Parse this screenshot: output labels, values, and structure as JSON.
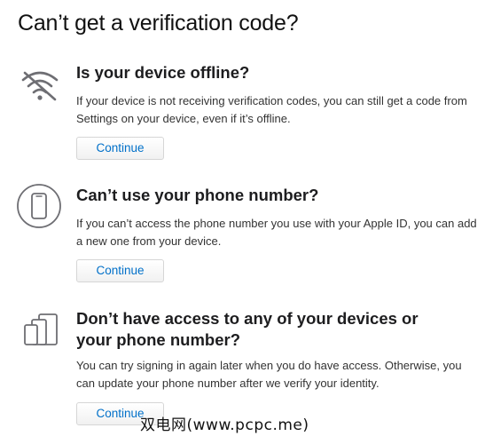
{
  "page": {
    "title": "Can’t get a verification code?"
  },
  "sections": [
    {
      "heading": "Is your device offline?",
      "body": "If your device is not receiving verification codes, you can still get a code from Settings on your device, even if it’s offline.",
      "button_label": "Continue",
      "icon": "wifi-off-icon"
    },
    {
      "heading": "Can’t use your phone number?",
      "body": "If you can’t access the phone number you use with your Apple ID, you can add a new one from your device.",
      "button_label": "Continue",
      "icon": "phone-icon"
    },
    {
      "heading": "Don’t have access to any of your devices or your phone number?",
      "body": "You can try signing in again later when you do have access. Otherwise, you can update your phone number after we verify your identity.",
      "button_label": "Continue",
      "icon": "devices-icon"
    }
  ],
  "watermark": {
    "text": "双电网(www.pcpc.me)"
  },
  "colors": {
    "link": "#0070c9",
    "icon": "#6e6e73",
    "text": "#1d1d1f"
  }
}
